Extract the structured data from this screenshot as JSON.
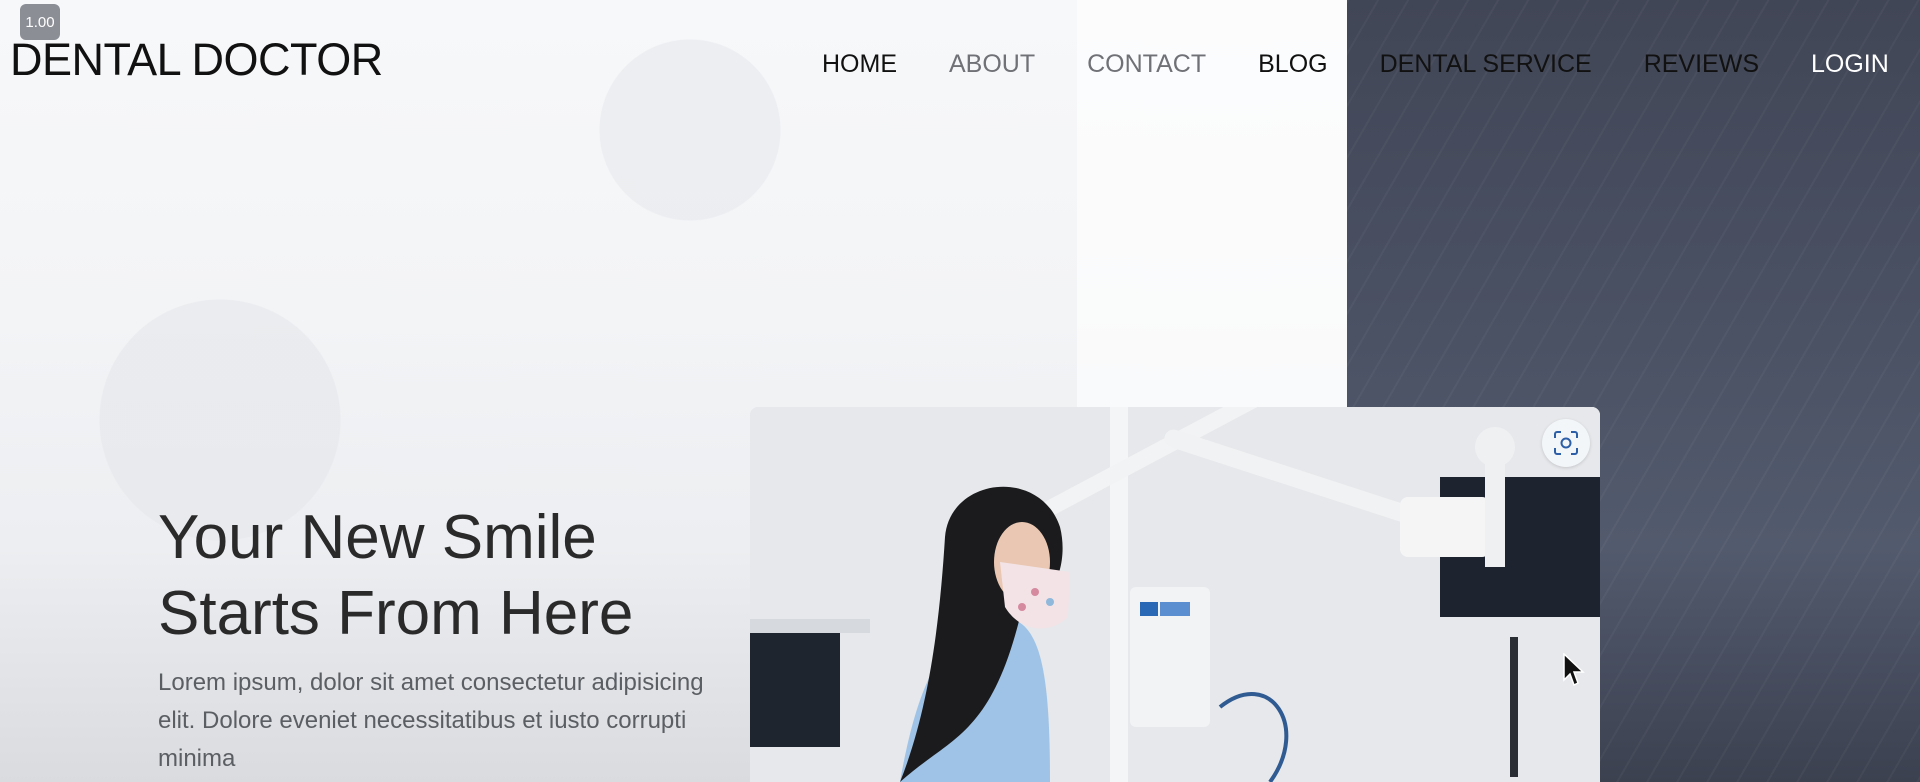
{
  "zoom": {
    "label": "1.00"
  },
  "header": {
    "logo": "DENTAL DOCTOR",
    "nav": [
      {
        "label": "HOME"
      },
      {
        "label": "ABOUT"
      },
      {
        "label": "CONTACT"
      },
      {
        "label": "BLOG"
      },
      {
        "label": "DENTAL SERVICE"
      },
      {
        "label": "REVIEWS"
      },
      {
        "label": "LOGIN"
      }
    ]
  },
  "hero": {
    "title_line1": "Your New Smile",
    "title_line2": "Starts From Here",
    "subtitle": "Lorem ipsum, dolor sit amet consectetur adipisicing elit. Dolore eveniet necessitatibus et iusto corrupti minima"
  },
  "icons": {
    "scan": "scan-icon",
    "cursor": "mouse-pointer-icon"
  },
  "colors": {
    "dark_panel": "#4a5163",
    "accent_icon": "#2c5fa8"
  }
}
